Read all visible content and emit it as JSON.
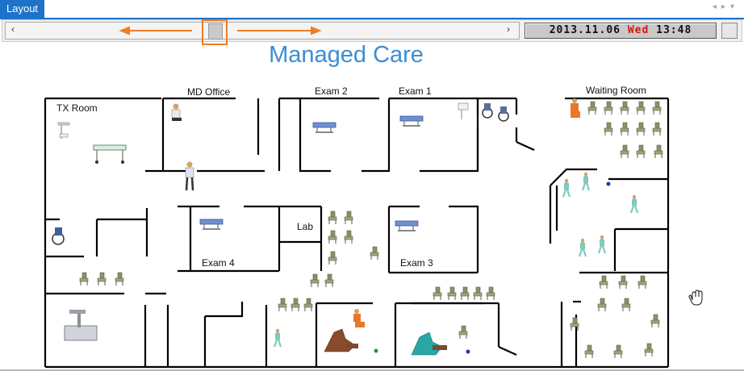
{
  "window": {
    "tab_label": "Layout"
  },
  "toolbar": {
    "scroll_left": "‹",
    "scroll_right": "›",
    "clock": {
      "date": "2013.11.06",
      "weekday": "Wed",
      "time": "13:48"
    }
  },
  "page_title": "Managed Care",
  "rooms": {
    "tx_room": "TX Room",
    "md_office": "MD Office",
    "exam2": "Exam 2",
    "exam1": "Exam 1",
    "waiting_room": "Waiting Room",
    "lab": "Lab",
    "exam4": "Exam 4",
    "exam3": "Exam 3"
  },
  "colors": {
    "accent": "#1e73c8",
    "title": "#3b8dd4",
    "highlight": "#f07c24",
    "weekday": "#e01010"
  }
}
